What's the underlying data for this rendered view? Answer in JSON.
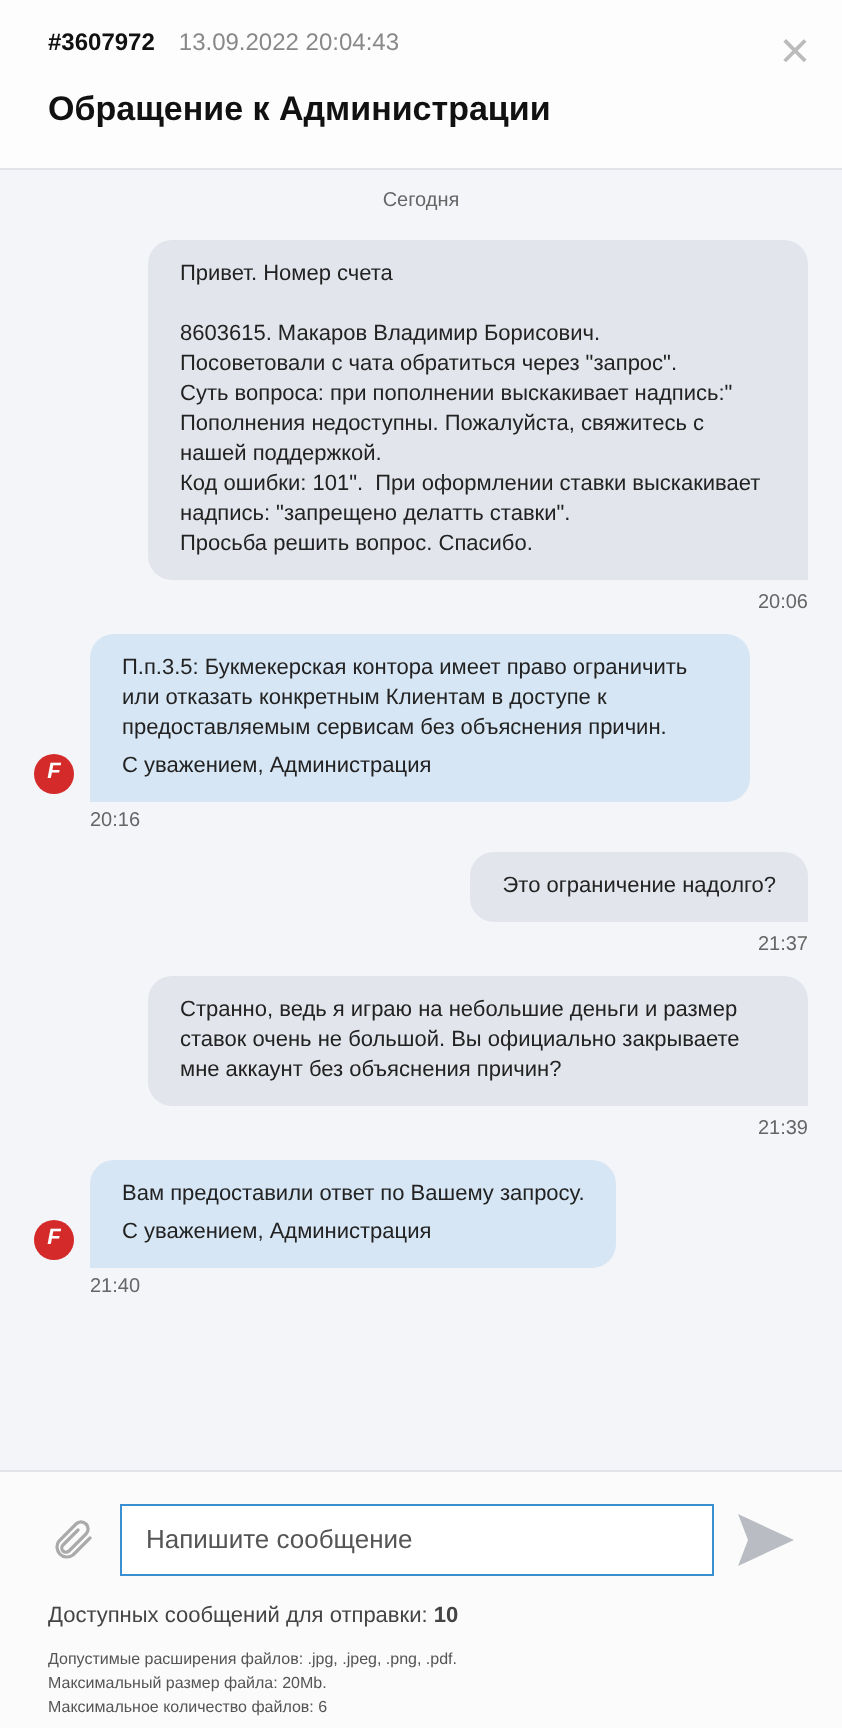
{
  "header": {
    "ticket_id": "#3607972",
    "datetime": "13.09.2022 20:04:43",
    "title": "Обращение к Администрации",
    "close": "×"
  },
  "chat": {
    "day": "Сегодня",
    "messages": [
      {
        "kind": "user",
        "paragraphs": [
          "Привет. Номер счета\n\n8603615. Макаров Владимир Борисович.\nПосоветовали с чата обратиться через \"запрос\".\nСуть вопроса: при пополнении выскакивает надпись:\" Пополнения недоступны. Пожалуйста, свяжитесь с нашей поддержкой.\nКод ошибки: 101\".  При оформлении ставки выскакивает надпись: \"запрещено делатть ставки\".\nПросьба решить вопрос. Спасибо."
        ],
        "time": "20:06"
      },
      {
        "kind": "admin",
        "avatar": "F",
        "paragraphs": [
          "П.п.3.5: Букмекерская контора имеет право ограничить или отказать конкретным Клиентам в доступе к предоставляемым сервисам без объяснения причин.",
          "С уважением, Администрация"
        ],
        "time": "20:16"
      },
      {
        "kind": "user",
        "paragraphs": [
          "Это ограничение надолго?"
        ],
        "time": "21:37"
      },
      {
        "kind": "user",
        "paragraphs": [
          "Странно, ведь я играю на небольшие деньги и размер ставок очень не большой. Вы официально закрываете мне аккаунт без объяснения причин?"
        ],
        "time": "21:39"
      },
      {
        "kind": "admin",
        "avatar": "F",
        "paragraphs": [
          "Вам предоставили ответ по Вашему запросу.",
          "С уважением, Администрация"
        ],
        "time": "21:40"
      }
    ]
  },
  "composer": {
    "placeholder": "Напишите сообщение",
    "available": "Доступных сообщений для отправки: **10**",
    "rules": [
      "Допустимые расширения файлов: .jpg, .jpeg, .png, .pdf.",
      "Максимальный размер файла: 20Mb.",
      "Максимальное количество файлов: 6"
    ]
  }
}
